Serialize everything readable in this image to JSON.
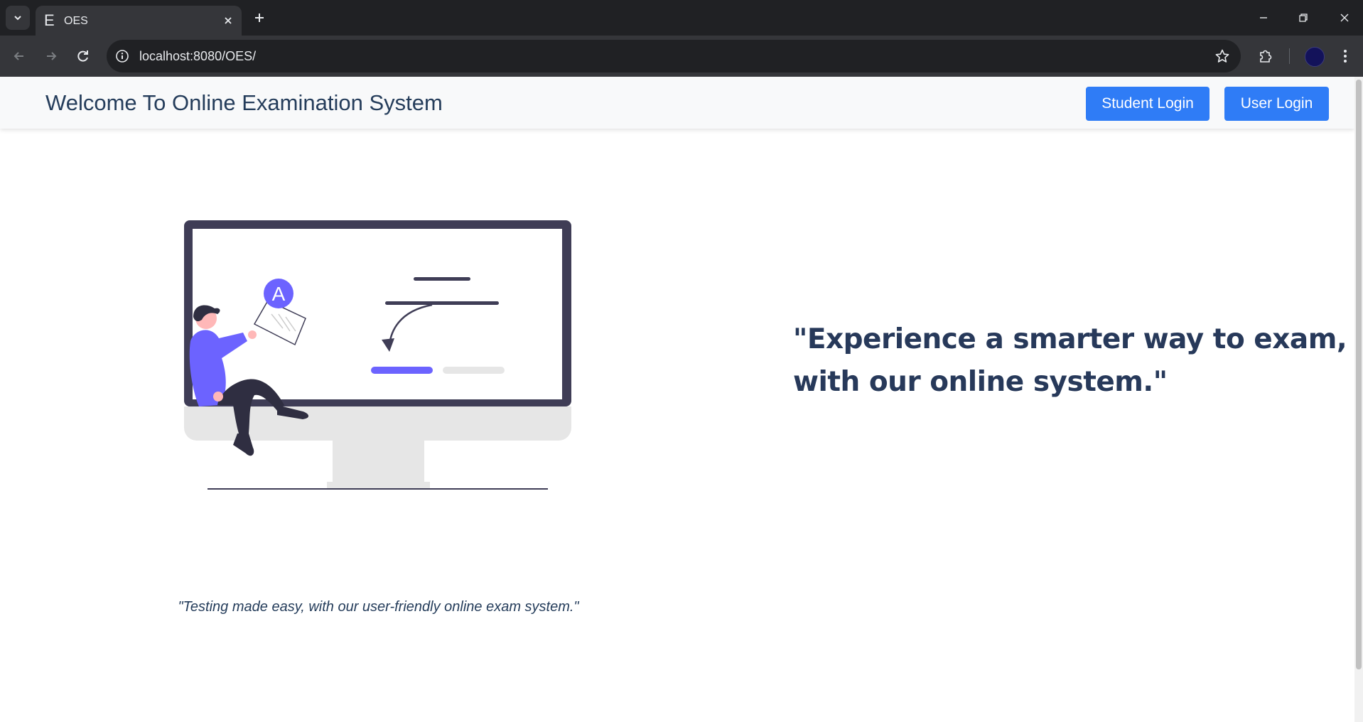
{
  "browser": {
    "tab": {
      "favicon": "E",
      "title": "OES"
    },
    "address_bar": {
      "url": "localhost:8080/OES/"
    },
    "icons": [
      "tab-search-icon",
      "close-icon",
      "plus-icon",
      "back-icon",
      "forward-icon",
      "reload-icon",
      "site-info-icon",
      "bookmark-star-icon",
      "extensions-icon",
      "more-vert-icon",
      "minimize-icon",
      "restore-icon",
      "window-close-icon"
    ]
  },
  "header": {
    "title": "Welcome To Online Examination System",
    "buttons": {
      "student_login": "Student Login",
      "user_login": "User Login"
    }
  },
  "hero": {
    "illustration_letter": "A",
    "caption": "\"Testing made easy, with our user-friendly online exam system.\"",
    "tagline_line1": "\"Experience a smarter way to exam,",
    "tagline_line2": "with our online system.\""
  },
  "colors": {
    "primary_button": "#2f7cf6",
    "heading_text": "#253d5b",
    "accent_purple": "#6c63ff",
    "monitor_dark": "#3f3d56"
  }
}
